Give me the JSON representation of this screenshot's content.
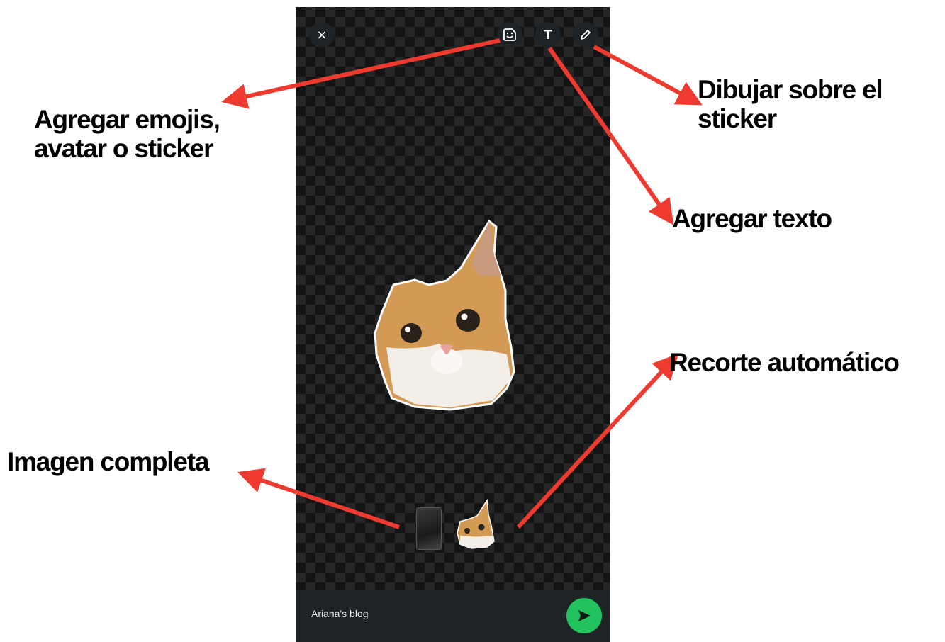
{
  "toolbar": {
    "close_icon": "×",
    "emoji_icon": "sticker-smile",
    "text_icon": "T",
    "draw_icon": "pencil"
  },
  "annotations": {
    "emoji_line1": "Agregar emojis,",
    "emoji_line2": "avatar o sticker",
    "draw_line1": "Dibujar sobre el",
    "draw_line2": "sticker",
    "text": "Agregar texto",
    "auto_cut": "Recorte automático",
    "full_image": "Imagen completa"
  },
  "caption": {
    "value": "Ariana's blog"
  },
  "colors": {
    "arrow": "#ef3b2f",
    "send": "#22c35e"
  }
}
